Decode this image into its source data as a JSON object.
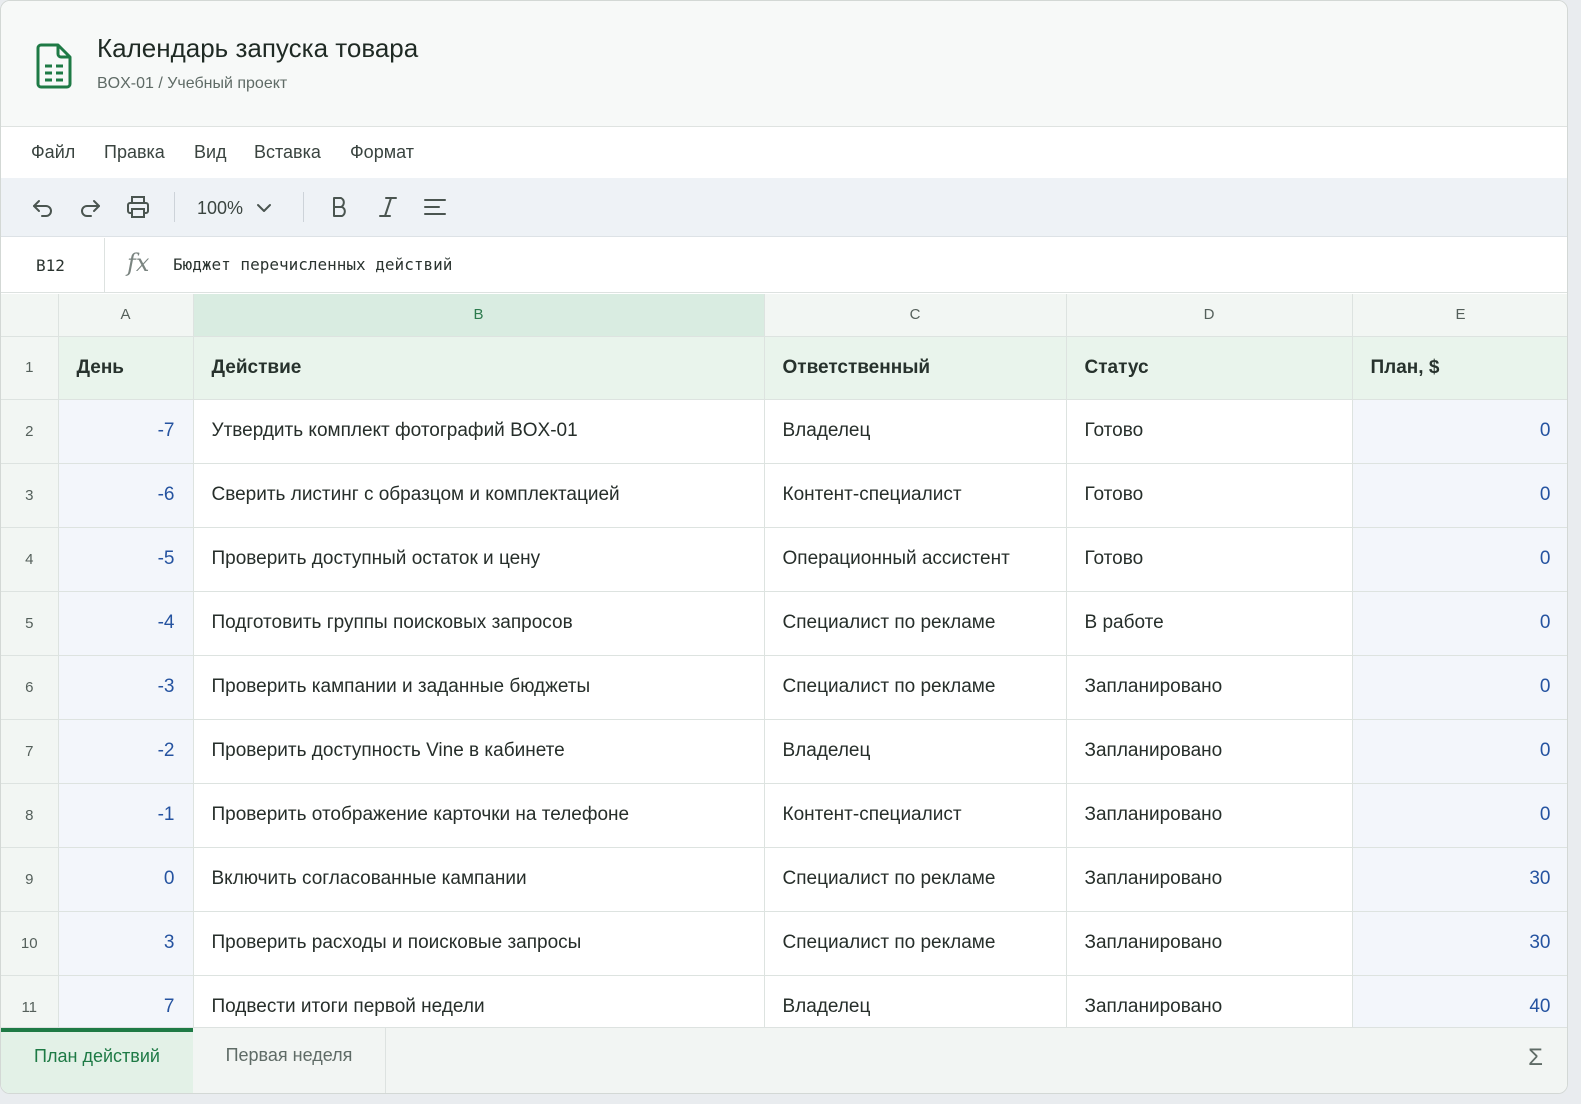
{
  "document": {
    "title": "Календарь запуска товара",
    "subtitle": "BOX-01 / Учебный проект"
  },
  "menu": [
    "Файл",
    "Правка",
    "Вид",
    "Вставка",
    "Формат"
  ],
  "toolbar": {
    "zoom": "100%",
    "icons": [
      "undo-icon",
      "redo-icon",
      "print-icon",
      "bold-icon",
      "italic-icon",
      "align-icon"
    ]
  },
  "formula_bar": {
    "cell_ref": "B12",
    "fx_label": "fx",
    "value": "Бюджет перечисленных действий"
  },
  "grid": {
    "columns": [
      "A",
      "B",
      "C",
      "D",
      "E"
    ],
    "selected_column": "B",
    "header_row": {
      "row_num": "1",
      "cells": [
        "День",
        "Действие",
        "Ответственный",
        "Статус",
        "План, $"
      ]
    },
    "rows": [
      {
        "row_num": "2",
        "day": "-7",
        "action": "Утвердить комплект фотографий BOX-01",
        "owner": "Владелец",
        "status": "Готово",
        "plan": "0"
      },
      {
        "row_num": "3",
        "day": "-6",
        "action": "Сверить листинг с образцом и комплектацией",
        "owner": "Контент-специалист",
        "status": "Готово",
        "plan": "0"
      },
      {
        "row_num": "4",
        "day": "-5",
        "action": "Проверить доступный остаток и цену",
        "owner": "Операционный ассистент",
        "status": "Готово",
        "plan": "0"
      },
      {
        "row_num": "5",
        "day": "-4",
        "action": "Подготовить группы поисковых запросов",
        "owner": "Специалист по рекламе",
        "status": "В работе",
        "plan": "0"
      },
      {
        "row_num": "6",
        "day": "-3",
        "action": "Проверить кампании и заданные бюджеты",
        "owner": "Специалист по рекламе",
        "status": "Запланировано",
        "plan": "0"
      },
      {
        "row_num": "7",
        "day": "-2",
        "action": "Проверить доступность Vine в кабинете",
        "owner": "Владелец",
        "status": "Запланировано",
        "plan": "0"
      },
      {
        "row_num": "8",
        "day": "-1",
        "action": "Проверить отображение карточки на телефоне",
        "owner": "Контент-специалист",
        "status": "Запланировано",
        "plan": "0"
      },
      {
        "row_num": "9",
        "day": "0",
        "action": "Включить согласованные кампании",
        "owner": "Специалист по рекламе",
        "status": "Запланировано",
        "plan": "30"
      },
      {
        "row_num": "10",
        "day": "3",
        "action": "Проверить расходы и поисковые запросы",
        "owner": "Специалист по рекламе",
        "status": "Запланировано",
        "plan": "30"
      },
      {
        "row_num": "11",
        "day": "7",
        "action": "Подвести итоги первой недели",
        "owner": "Владелец",
        "status": "Запланировано",
        "plan": "40"
      }
    ]
  },
  "sheets": {
    "active": "План действий",
    "other": "Первая неделя",
    "sum_icon": "Σ"
  },
  "colors": {
    "accent": "#1e7a45",
    "number_text": "#2553a0",
    "header_fill": "#e9f4ec",
    "selected_column": "#d9ece1"
  }
}
